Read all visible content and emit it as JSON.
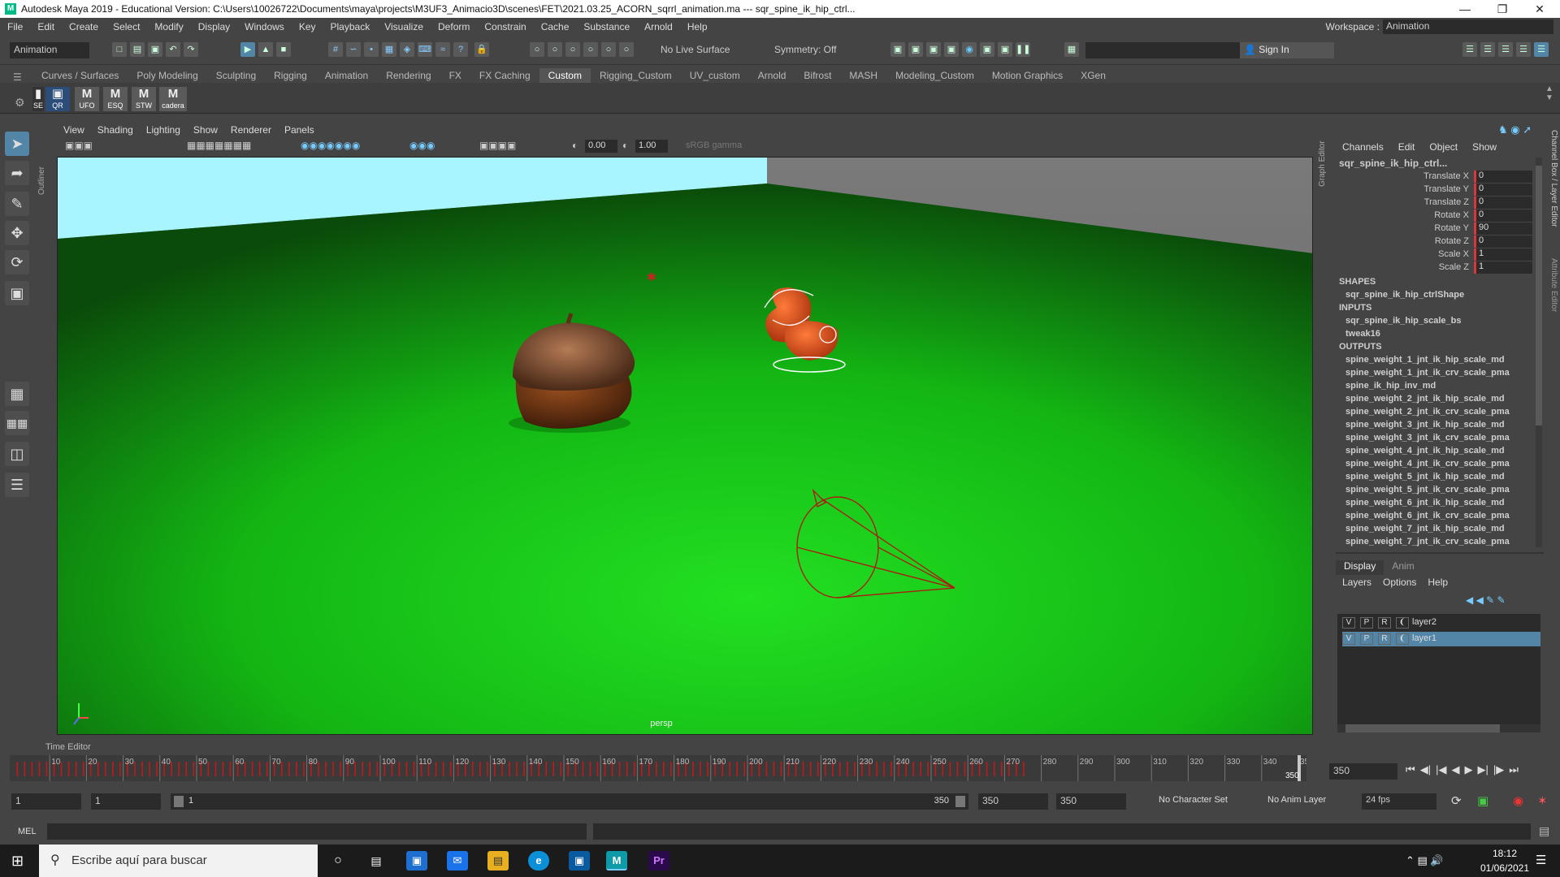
{
  "window": {
    "title": "Autodesk Maya 2019 - Educational Version: C:\\Users\\10026722\\Documents\\maya\\projects\\M3UF3_Animacio3D\\scenes\\FET\\2021.03.25_ACORN_sqrrl_animation.ma  ---  sqr_spine_ik_hip_ctrl...",
    "app_icon": "M"
  },
  "menubar": [
    "File",
    "Edit",
    "Create",
    "Select",
    "Modify",
    "Display",
    "Windows",
    "Key",
    "Playback",
    "Visualize",
    "Deform",
    "Constrain",
    "Cache",
    "Substance",
    "Arnold",
    "Help"
  ],
  "workspace": {
    "label": "Workspace :",
    "value": "Animation"
  },
  "statusline": {
    "menuset": "Animation",
    "live_surface": "No Live Surface",
    "symmetry": "Symmetry: Off",
    "sign_in": "Sign In"
  },
  "shelf_tabs": [
    "Curves / Surfaces",
    "Poly Modeling",
    "Sculpting",
    "Rigging",
    "Animation",
    "Rendering",
    "FX",
    "FX Caching",
    "Custom",
    "Rigging_Custom",
    "UV_custom",
    "Arnold",
    "Bifrost",
    "MASH",
    "Modeling_Custom",
    "Motion Graphics",
    "XGen"
  ],
  "shelf_active": "Custom",
  "shelf_buttons": [
    {
      "label": "SE"
    },
    {
      "label": "QR"
    },
    {
      "label": "UFO"
    },
    {
      "label": "ESQ"
    },
    {
      "label": "STW"
    },
    {
      "label": "cadera"
    }
  ],
  "outliner_label": "Outliner",
  "viewport": {
    "menu": [
      "View",
      "Shading",
      "Lighting",
      "Show",
      "Renderer",
      "Panels"
    ],
    "exposure": "0.00",
    "gamma": "1.00",
    "colorspace": "sRGB gamma",
    "camera_label": "persp",
    "floor_color": "#22e022",
    "sky_color": "#a8f4ff"
  },
  "channelbox": {
    "menu": [
      "Channels",
      "Edit",
      "Object",
      "Show"
    ],
    "object": "sqr_spine_ik_hip_ctrl...",
    "attributes": [
      {
        "name": "Translate X",
        "value": "0"
      },
      {
        "name": "Translate Y",
        "value": "0"
      },
      {
        "name": "Translate Z",
        "value": "0"
      },
      {
        "name": "Rotate X",
        "value": "0"
      },
      {
        "name": "Rotate Y",
        "value": "90"
      },
      {
        "name": "Rotate Z",
        "value": "0"
      },
      {
        "name": "Scale X",
        "value": "1"
      },
      {
        "name": "Scale Z",
        "value": "1"
      }
    ],
    "shapes_header": "SHAPES",
    "shapes": [
      "sqr_spine_ik_hip_ctrlShape"
    ],
    "inputs_header": "INPUTS",
    "inputs": [
      "sqr_spine_ik_hip_scale_bs",
      "tweak16"
    ],
    "outputs_header": "OUTPUTS",
    "outputs": [
      "spine_weight_1_jnt_ik_hip_scale_md",
      "spine_weight_1_jnt_ik_crv_scale_pma",
      "spine_ik_hip_inv_md",
      "spine_weight_2_jnt_ik_hip_scale_md",
      "spine_weight_2_jnt_ik_crv_scale_pma",
      "spine_weight_3_jnt_ik_hip_scale_md",
      "spine_weight_3_jnt_ik_crv_scale_pma",
      "spine_weight_4_jnt_ik_hip_scale_md",
      "spine_weight_4_jnt_ik_crv_scale_pma",
      "spine_weight_5_jnt_ik_hip_scale_md",
      "spine_weight_5_jnt_ik_crv_scale_pma",
      "spine_weight_6_jnt_ik_hip_scale_md",
      "spine_weight_6_jnt_ik_crv_scale_pma",
      "spine_weight_7_jnt_ik_hip_scale_md",
      "spine_weight_7_jnt_ik_crv_scale_pma"
    ],
    "side_tabs": [
      "Channel Box / Layer Editor",
      "Attribute Editor"
    ],
    "graph_editor_label": "Graph Editor"
  },
  "layer_editor": {
    "tabs": [
      "Display",
      "Anim"
    ],
    "menu": [
      "Layers",
      "Options",
      "Help"
    ],
    "layers": [
      {
        "v": "V",
        "p": "P",
        "r": "R",
        "name": "layer2",
        "selected": false
      },
      {
        "v": "V",
        "p": "P",
        "r": "R",
        "name": "layer1",
        "selected": true
      }
    ]
  },
  "time_editor_label": "Time Editor",
  "timeline": {
    "ticks": [
      "10",
      "20",
      "30",
      "40",
      "50",
      "60",
      "70",
      "80",
      "90",
      "100",
      "110",
      "120",
      "130",
      "140",
      "150",
      "160",
      "170",
      "180",
      "190",
      "200",
      "210",
      "220",
      "230",
      "240",
      "250",
      "260",
      "270",
      "280",
      "290",
      "300",
      "310",
      "320",
      "330",
      "340",
      "350"
    ],
    "current_frame": "350",
    "current_frame_field": "350",
    "key_color": "#c21a1a"
  },
  "range": {
    "start": "1",
    "anim_start": "1",
    "slider_start": "1",
    "slider_end": "350",
    "anim_end": "350",
    "end": "350",
    "character_set": "No Character Set",
    "anim_layer": "No Anim Layer",
    "fps": "24 fps"
  },
  "cmdline": {
    "label": "MEL"
  },
  "taskbar": {
    "search_placeholder": "Escribe aquí para buscar",
    "time": "18:12",
    "date": "01/06/2021"
  }
}
